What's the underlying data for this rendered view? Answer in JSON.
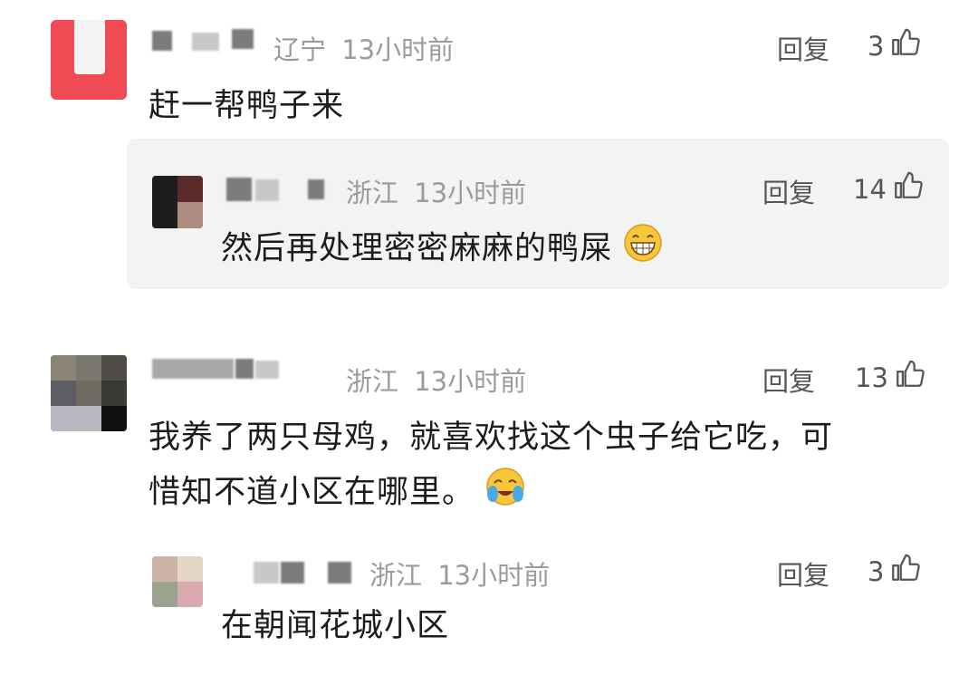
{
  "comments": [
    {
      "location": "辽宁",
      "time": "13小时前",
      "text": "赶一帮鸭子来",
      "reply_label": "回复",
      "likes": "3",
      "reply": {
        "location": "浙江",
        "time": "13小时前",
        "text": "然后再处理密密麻麻的鸭屎",
        "reply_label": "回复",
        "likes": "14"
      }
    },
    {
      "location": "浙江",
      "time": "13小时前",
      "text_line1": "我养了两只母鸡，就喜欢找这个虫子给它吃，可",
      "text_line2": "惜知不道小区在哪里。",
      "reply_label": "回复",
      "likes": "13",
      "reply": {
        "location": "浙江",
        "time": "13小时前",
        "text": "在朝闻花城小区",
        "reply_label": "回复",
        "likes": "3"
      }
    }
  ],
  "icons": {
    "like": "thumbs-up-icon",
    "emoji_grin": "grinning-face-emoji",
    "emoji_laugh_cry": "laughing-crying-face-emoji"
  }
}
